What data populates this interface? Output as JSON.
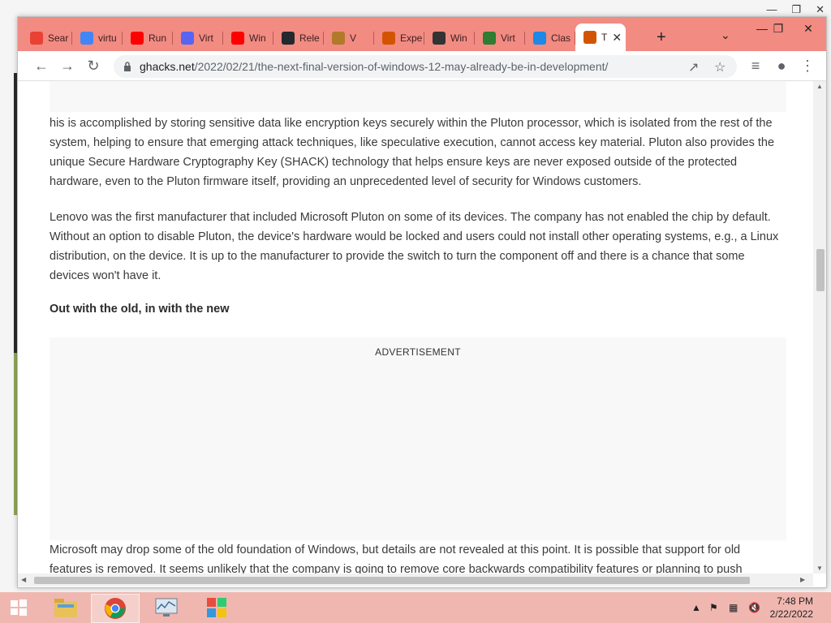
{
  "browser": {
    "tabs": [
      {
        "label": "Sear",
        "icon": "red-square-icon",
        "color": "#e94235"
      },
      {
        "label": "virtu",
        "icon": "google-icon",
        "color": "#4285f4"
      },
      {
        "label": "Run",
        "icon": "youtube-icon",
        "color": "#ff0000"
      },
      {
        "label": "Virt",
        "icon": "discord-icon",
        "color": "#5865f2"
      },
      {
        "label": "Win",
        "icon": "youtube-icon",
        "color": "#ff0000"
      },
      {
        "label": "Rele",
        "icon": "github-icon",
        "color": "#24292e"
      },
      {
        "label": "V",
        "icon": "audio-icon",
        "color": "#b07a2a"
      },
      {
        "label": "Expe",
        "icon": "ghacks-icon",
        "color": "#d35400"
      },
      {
        "label": "Win",
        "icon": "library-icon",
        "color": "#333333"
      },
      {
        "label": "Virt",
        "icon": "manual-icon",
        "color": "#2e7d32"
      },
      {
        "label": "Clas",
        "icon": "picture-icon",
        "color": "#1e88e5"
      },
      {
        "label": "T",
        "icon": "ghacks-icon",
        "color": "#d35400",
        "active": true
      }
    ],
    "url_host": "ghacks.net",
    "url_path": "/2022/02/21/the-next-final-version-of-windows-12-may-already-be-in-development/",
    "accent": "#f28b82"
  },
  "article": {
    "para1": "his is accomplished by storing sensitive data like encryption keys securely within the Pluton processor, which is isolated from the rest of the system, helping to ensure that emerging attack techniques, like speculative execution, cannot access key material. Pluton also provides the unique Secure Hardware Cryptography Key (SHACK) technology that helps ensure keys are never exposed outside of the protected hardware, even to the Pluton firmware itself, providing an unprecedented level of security for Windows customers.",
    "para2": "Lenovo was the first manufacturer that included Microsoft Pluton on some of its devices. The company has not enabled the chip by default. Without an option to disable Pluton, the device's hardware would be locked and users could not install other operating systems, e.g., a Linux distribution, on the device. It is up to the manufacturer to provide the switch to turn the component off and there is a chance that some devices won't have it.",
    "heading": "Out with the old, in with the new",
    "ad_label": "ADVERTISEMENT",
    "para3": "Microsoft may drop some of the old foundation of Windows, but details are not revealed at this point. It is possible that support for old features is removed. It seems unlikely that the company is going to remove core backwards compatibility features or planning to push"
  },
  "taskbar": {
    "time": "7:48 PM",
    "date": "2/22/2022"
  }
}
